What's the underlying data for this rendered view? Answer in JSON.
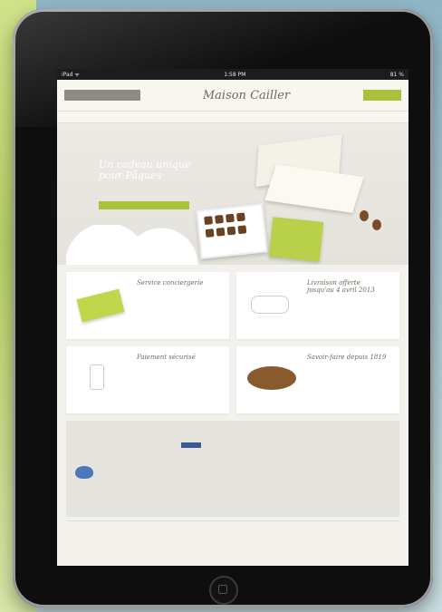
{
  "status_bar": {
    "carrier": "iPad ᯤ",
    "time": "1:58 PM",
    "battery": "81 %"
  },
  "header": {
    "left_button": "",
    "logo": "Maison Cailler",
    "links": [
      "",
      ""
    ],
    "right_button": ""
  },
  "nav": {
    "left": [
      "",
      ""
    ],
    "right": [
      "",
      ""
    ]
  },
  "hero": {
    "title": "Un cadeau unique pour Pâques",
    "subtitle": "",
    "cta": ""
  },
  "cards": [
    {
      "title": "Service conciergerie",
      "text": ""
    },
    {
      "title": "Livraison offerte jusqu'au 4 avril 2013",
      "text": ""
    },
    {
      "title": "Paiement sécurisé",
      "text": ""
    },
    {
      "title": "Savoir-faire depuis 1819",
      "text": ""
    }
  ],
  "footer": {
    "col1_title": "",
    "col1_text": "",
    "col2_title": "",
    "col2_text": "",
    "col2_fb": "",
    "col3_title": "",
    "col3_text": ""
  },
  "bottom_links": [
    "",
    "",
    "",
    "",
    "",
    "",
    ""
  ],
  "colors": {
    "accent": "#a9c23a",
    "bezel": "#0e0e0e",
    "screen_bg": "#f2f1ec"
  }
}
